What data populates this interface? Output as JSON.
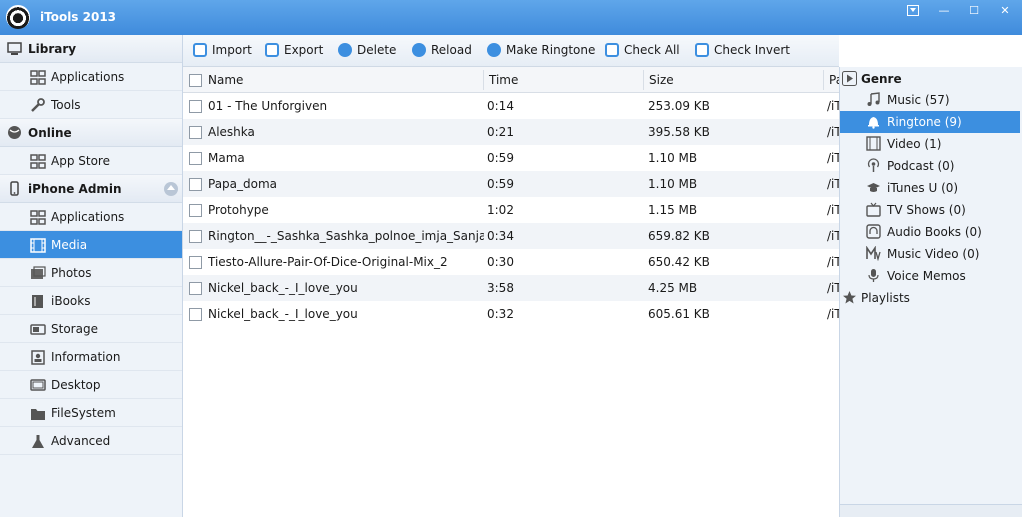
{
  "app": {
    "title": "iTools 2013"
  },
  "window_controls": {
    "minimize": "—",
    "maximize": "☐",
    "close": "✕"
  },
  "sidebar": {
    "library": {
      "label": "Library",
      "items": [
        {
          "label": "Applications"
        },
        {
          "label": "Tools"
        }
      ]
    },
    "online": {
      "label": "Online",
      "items": [
        {
          "label": "App Store"
        }
      ]
    },
    "iphone": {
      "label": "iPhone Admin",
      "items": [
        {
          "label": "Applications"
        },
        {
          "label": "Media"
        },
        {
          "label": "Photos"
        },
        {
          "label": "iBooks"
        },
        {
          "label": "Storage"
        },
        {
          "label": "Information"
        },
        {
          "label": "Desktop"
        },
        {
          "label": "FileSystem"
        },
        {
          "label": "Advanced"
        }
      ]
    }
  },
  "toolbar": {
    "import": "Import",
    "export": "Export",
    "delete": "Delete",
    "reload": "Reload",
    "make_ringtone": "Make Ringtone",
    "check_all": "Check All",
    "check_invert": "Check Invert"
  },
  "table": {
    "columns": {
      "name": "Name",
      "time": "Time",
      "size": "Size",
      "path": "Pa"
    },
    "rows": [
      {
        "name": "01 - The Unforgiven",
        "time": "0:14",
        "size": "253.09 KB",
        "path": "/iT"
      },
      {
        "name": "Aleshka",
        "time": "0:21",
        "size": "395.58 KB",
        "path": "/iT"
      },
      {
        "name": "Mama",
        "time": "0:59",
        "size": "1.10 MB",
        "path": "/iT"
      },
      {
        "name": "Papa_doma",
        "time": "0:59",
        "size": "1.10 MB",
        "path": "/iT"
      },
      {
        "name": "Protohype",
        "time": "1:02",
        "size": "1.15 MB",
        "path": "/iT"
      },
      {
        "name": "Rington__-_Sashka_Sashka_polnoe_imja_Sanja_Sas...",
        "time": "0:34",
        "size": "659.82 KB",
        "path": "/iT"
      },
      {
        "name": "Tiesto-Allure-Pair-Of-Dice-Original-Mix_2",
        "time": "0:30",
        "size": "650.42 KB",
        "path": "/iT"
      },
      {
        "name": "Nickel_back_-_I_love_you",
        "time": "3:58",
        "size": "4.25 MB",
        "path": "/iT"
      },
      {
        "name": "Nickel_back_-_I_love_you",
        "time": "0:32",
        "size": "605.61 KB",
        "path": "/iT"
      }
    ]
  },
  "genre_panel": {
    "title": "Genre",
    "items": [
      {
        "label": "Music (57)"
      },
      {
        "label": "Ringtone (9)"
      },
      {
        "label": "Video (1)"
      },
      {
        "label": "Podcast (0)"
      },
      {
        "label": "iTunes U (0)"
      },
      {
        "label": "TV Shows (0)"
      },
      {
        "label": "Audio Books (0)"
      },
      {
        "label": "Music Video (0)"
      },
      {
        "label": "Voice Memos"
      }
    ],
    "playlists": "Playlists"
  },
  "colors": {
    "accent": "#3c8fe0",
    "titlebar": "#4a95e2"
  }
}
